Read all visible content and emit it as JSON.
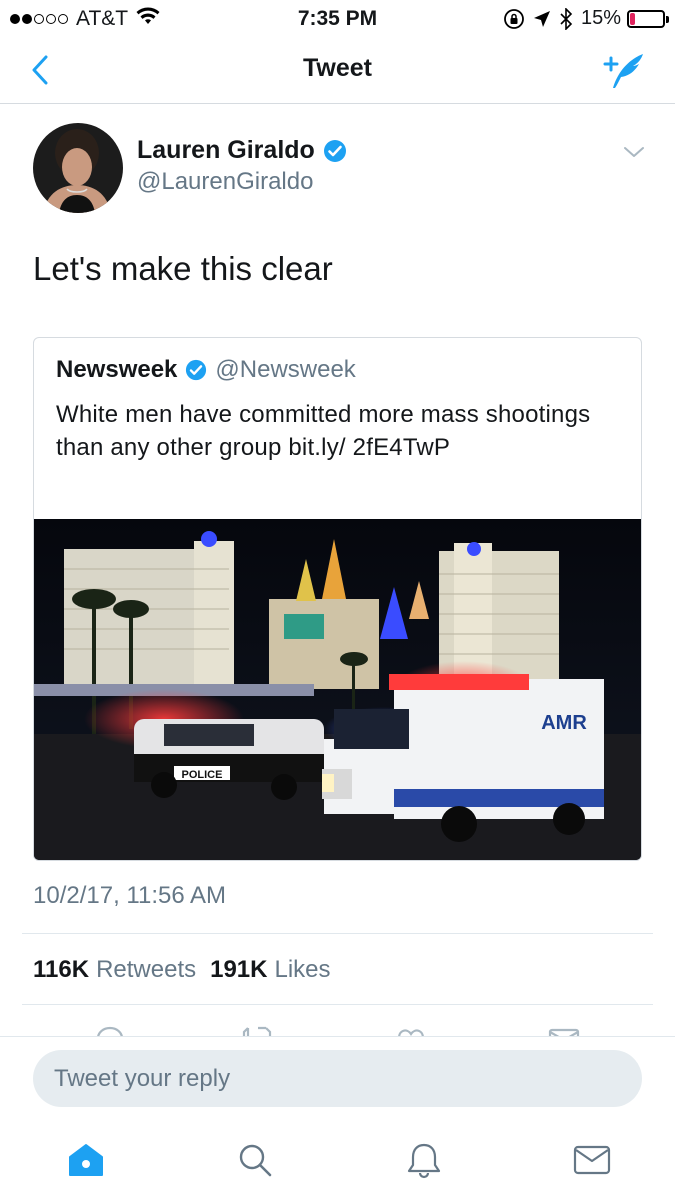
{
  "status_bar": {
    "carrier": "AT&T",
    "time": "7:35 PM",
    "battery_percent": "15%",
    "battery_level": 0.15,
    "signal_bars": 2,
    "signal_total": 5
  },
  "nav": {
    "title": "Tweet"
  },
  "tweet": {
    "display_name": "Lauren Giraldo",
    "handle": "@LaurenGiraldo",
    "verified": true,
    "text": "Let's make this clear",
    "timestamp": "10/2/17, 11:56 AM",
    "retweets_count": "116K",
    "retweets_label": "Retweets",
    "likes_count": "191K",
    "likes_label": "Likes"
  },
  "quoted_tweet": {
    "display_name": "Newsweek",
    "handle": "@Newsweek",
    "verified": true,
    "text": "White men have committed more mass shootings than any other group bit.ly/ 2fE4TwP",
    "image_signs": {
      "police": "POLICE",
      "ambulance": "AMR"
    }
  },
  "reply": {
    "placeholder": "Tweet your reply"
  },
  "colors": {
    "accent": "#1da1f2",
    "secondary_text": "#657786",
    "battery_low": "#e0245e"
  },
  "tab_bar": [
    "home-icon",
    "search-icon",
    "notifications-icon",
    "messages-icon"
  ]
}
